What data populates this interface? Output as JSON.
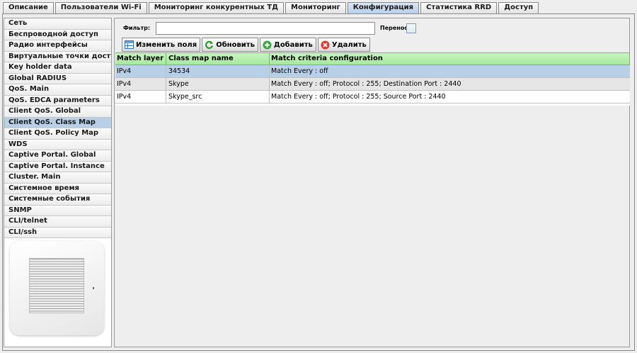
{
  "tabs": [
    {
      "label": "Описание",
      "active": false
    },
    {
      "label": "Пользователи Wi-Fi",
      "active": false
    },
    {
      "label": "Мониторинг конкурентных ТД",
      "active": false
    },
    {
      "label": "Мониторинг",
      "active": false
    },
    {
      "label": "Конфигурация",
      "active": true
    },
    {
      "label": "Статистика RRD",
      "active": false
    },
    {
      "label": "Доступ",
      "active": false
    }
  ],
  "sidebar": {
    "items": [
      "Сеть",
      "Беспроводной доступ",
      "Радио интерфейсы",
      "Виртуальные точки доступа",
      "Key holder data",
      "Global RADIUS",
      "QoS. Main",
      "QoS. EDCA parameters",
      "Client QoS. Global",
      "Client QoS. Class Map",
      "Client QoS. Policy Map",
      "WDS",
      "Captive Portal. Global",
      "Captive Portal. Instance",
      "Cluster. Main",
      "Системное время",
      "Системные события",
      "SNMP",
      "CLI/telnet",
      "CLI/ssh"
    ],
    "selected_index": 9,
    "device_icon": "access-point-icon"
  },
  "filter": {
    "label": "Фильтр:",
    "value": "",
    "wrap_label": "Перенос",
    "wrap_checked": false
  },
  "toolbar": {
    "edit_label": "Изменить поля",
    "refresh_label": "Обновить",
    "add_label": "Добавить",
    "delete_label": "Удалить"
  },
  "table": {
    "headers": [
      "Match layer 3...",
      "Class map name",
      "Match criteria configuration"
    ],
    "rows": [
      [
        "IPv4",
        "34534",
        "Match Every : off"
      ],
      [
        "IPv4",
        "Skype",
        "Match Every : off; Protocol : 255; Destination Port : 2440"
      ],
      [
        "IPv4",
        "Skype_src",
        "Match Every : off; Protocol : 255; Source Port : 2440"
      ]
    ],
    "selected_row": 0
  },
  "colors": {
    "header_green": "#a6e89c",
    "selection_blue": "#b8cfe8",
    "active_tab": "#b8cfe8"
  }
}
